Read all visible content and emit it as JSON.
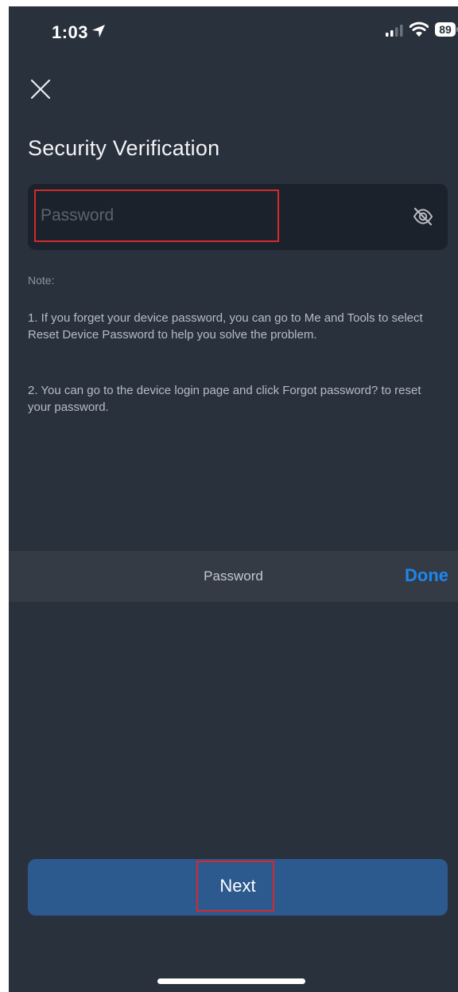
{
  "status_bar": {
    "time": "1:03",
    "battery": "89"
  },
  "icons": {
    "close": "close-icon",
    "visibility": "eye-off-icon",
    "location": "location-arrow-icon",
    "signal": "cellular-signal-icon",
    "wifi": "wifi-icon"
  },
  "page": {
    "title": "Security Verification"
  },
  "password_field": {
    "placeholder": "Password",
    "value": ""
  },
  "notes": {
    "title": "Note:",
    "items": [
      "1. If you forget your device password, you can go to Me and Tools to select Reset Device Password to help you solve the problem.",
      "2. You can go to the device login page and click Forgot password? to reset your password."
    ]
  },
  "keyboard_toolbar": {
    "label": "Password",
    "done_label": "Done"
  },
  "actions": {
    "next_label": "Next"
  },
  "colors": {
    "background": "#29313d",
    "field_background": "#1c222b",
    "primary_button": "#2d5a8e",
    "highlight_border": "#d32a2e",
    "done_text": "#1e86f0"
  }
}
